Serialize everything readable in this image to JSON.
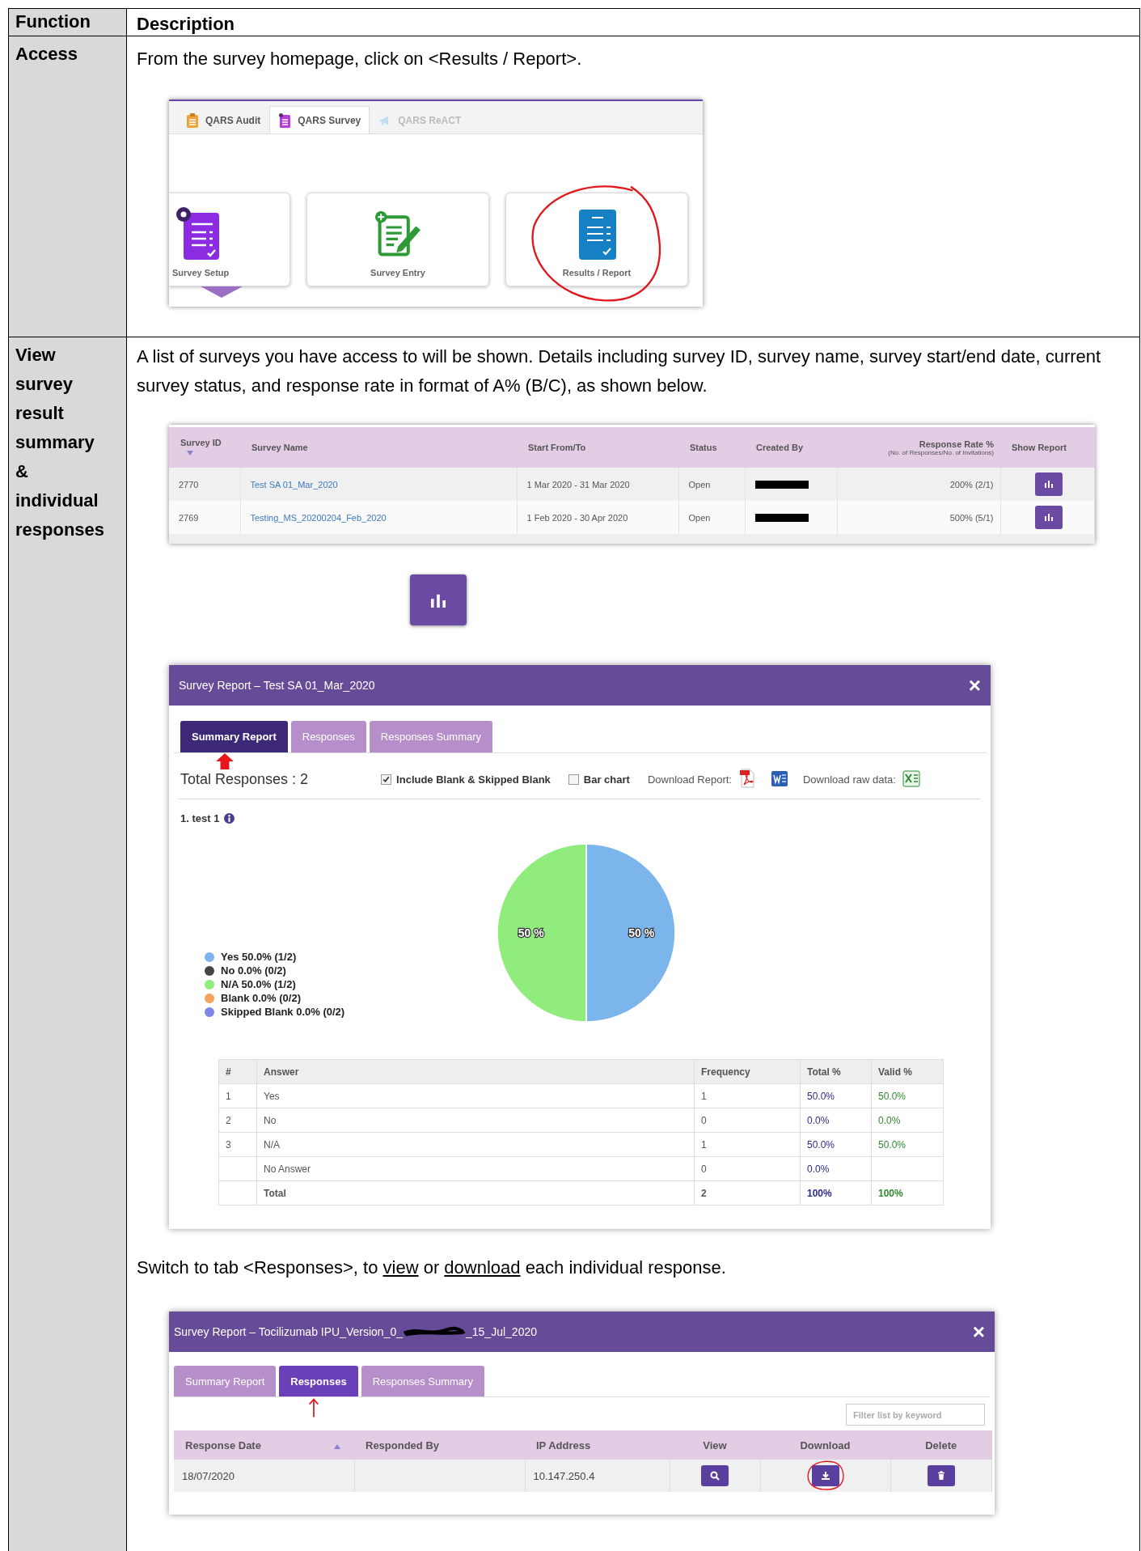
{
  "header": {
    "function": "Function",
    "description": "Description"
  },
  "access": {
    "label": "Access",
    "instruction": "From the survey homepage, click on <Results / Report>.",
    "module_tabs": [
      {
        "label": "QARS Audit",
        "kind": "audit",
        "selected": false,
        "disabled": false
      },
      {
        "label": "QARS Survey",
        "kind": "survey",
        "selected": true,
        "disabled": false
      },
      {
        "label": "QARS ReACT",
        "kind": "react",
        "selected": false,
        "disabled": true
      }
    ],
    "tiles": [
      {
        "label": "Survey Setup",
        "kind": "setup",
        "selected": true,
        "circled": false
      },
      {
        "label": "Survey Entry",
        "kind": "entry",
        "selected": false,
        "circled": false
      },
      {
        "label": "Results / Report",
        "kind": "results",
        "selected": false,
        "circled": true
      }
    ]
  },
  "view": {
    "label": "View survey result summary & individual responses",
    "intro": "A list of surveys you have access to will be shown. Details including survey ID, survey name, survey start/end date, current survey status, and response rate in format of A% (B/C), as shown below.",
    "survey_list": {
      "columns": [
        "Survey ID",
        "Survey Name",
        "Start From/To",
        "Status",
        "Created By",
        "Response Rate %",
        "Show Report"
      ],
      "rate_note": "(No. of Responses/No. of Invitations)",
      "rows": [
        {
          "id": "2770",
          "name": "Test SA 01_Mar_2020",
          "period": "1 Mar 2020 - 31 Mar 2020",
          "status": "Open",
          "created_by_redacted": true,
          "rate": "200% (2/1)"
        },
        {
          "id": "2769",
          "name": "Testing_MS_20200204_Feb_2020",
          "period": "1 Feb 2020 - 30 Apr 2020",
          "status": "Open",
          "created_by_redacted": true,
          "rate": "500% (5/1)"
        }
      ]
    },
    "summary_report": {
      "title": "Survey Report – Test SA 01_Mar_2020",
      "close": "×",
      "tabs": [
        {
          "label": "Summary Report",
          "selected": true,
          "pointed": true
        },
        {
          "label": "Responses",
          "selected": false,
          "pointed": false
        },
        {
          "label": "Responses Summary",
          "selected": false,
          "pointed": false
        }
      ],
      "total": "Total Responses : 2",
      "options": [
        {
          "label": "Include Blank & Skipped Blank",
          "checked": true
        },
        {
          "label": "Bar chart",
          "checked": false
        }
      ],
      "download_report": "Download Report:",
      "download_raw": "Download raw data:",
      "question": "1. test 1",
      "legend": [
        {
          "label": "Yes 50.0% (1/2)",
          "color": "#7cb5ec"
        },
        {
          "label": "No 0.0% (0/2)",
          "color": "#434348"
        },
        {
          "label": "N/A 50.0% (1/2)",
          "color": "#90ed7d"
        },
        {
          "label": "Blank 0.0% (0/2)",
          "color": "#f7a35c"
        },
        {
          "label": "Skipped Blank 0.0% (0/2)",
          "color": "#8085e9"
        }
      ],
      "chart_data": {
        "type": "pie",
        "values": [
          50,
          0,
          50,
          0,
          0
        ],
        "value_labels": [
          "50 %",
          null,
          "50 %",
          null,
          null
        ]
      },
      "table": {
        "columns": [
          "#",
          "Answer",
          "Frequency",
          "Total %",
          "Valid %"
        ],
        "rows": [
          {
            "kind": "answer",
            "cells": [
              "1",
              "Yes",
              "1",
              "50.0%",
              "50.0%"
            ]
          },
          {
            "kind": "answer",
            "cells": [
              "2",
              "No",
              "0",
              "0.0%",
              "0.0%"
            ]
          },
          {
            "kind": "answer",
            "cells": [
              "3",
              "N/A",
              "1",
              "50.0%",
              "50.0%"
            ]
          },
          {
            "kind": "answer",
            "cells": [
              null,
              "No Answer",
              "0",
              "0.0%",
              null
            ]
          },
          {
            "kind": "total",
            "cells": [
              null,
              "Total",
              "2",
              "100%",
              "100%"
            ]
          }
        ]
      }
    },
    "switch_note": "Switch to tab <Responses>, to *view* or *download* each individual response.",
    "responses_report": {
      "title_start": "Survey Report – Tocilizumab IPU_Version_0_",
      "title_end": "_15_Jul_2020",
      "close": "×",
      "tabs": [
        {
          "label": "Summary Report",
          "selected": false,
          "pointed": false
        },
        {
          "label": "Responses",
          "selected": true,
          "pointed": true
        },
        {
          "label": "Responses Summary",
          "selected": false,
          "pointed": false
        }
      ],
      "filter_placeholder": "Filter list by keyword",
      "columns": [
        {
          "label": "Response Date",
          "kind": "date",
          "sorted": true,
          "circled": false
        },
        {
          "label": "Responded By",
          "kind": "person",
          "sorted": false,
          "circled": false
        },
        {
          "label": "IP Address",
          "kind": "ip",
          "sorted": false,
          "circled": false
        },
        {
          "label": "View",
          "kind": "view",
          "sorted": false,
          "circled": false
        },
        {
          "label": "Download",
          "kind": "download",
          "sorted": false,
          "circled": true
        },
        {
          "label": "Delete",
          "kind": "delete",
          "sorted": false,
          "circled": false
        }
      ],
      "rows": [
        {
          "date": "18/07/2020",
          "ip": "10.147.250.4"
        }
      ]
    }
  }
}
